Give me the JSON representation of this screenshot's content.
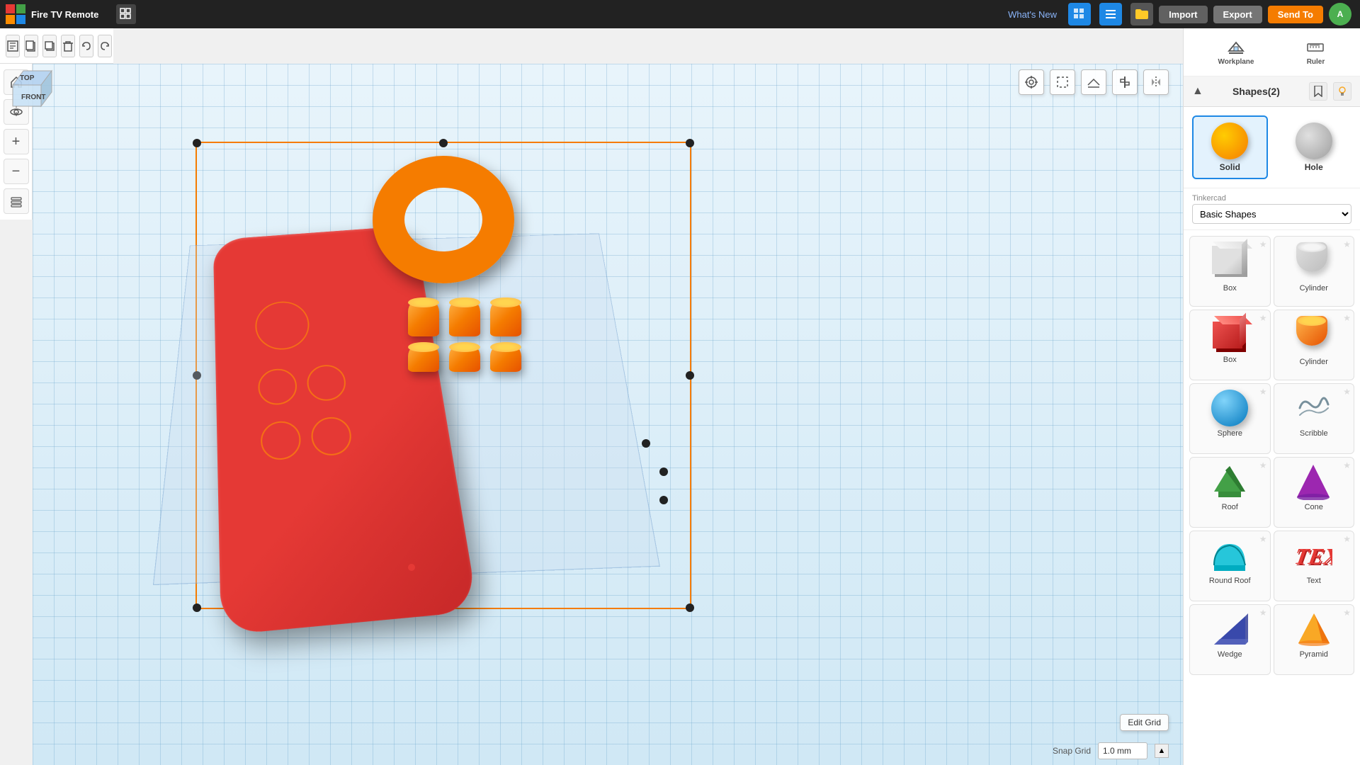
{
  "app": {
    "title": "Fire TV Remote",
    "logo_text": "TIN KER CAD"
  },
  "topbar": {
    "whats_new": "What's New",
    "import_label": "Import",
    "export_label": "Export",
    "send_to_label": "Send To"
  },
  "toolbar": {
    "new_label": "New",
    "copy_label": "Copy",
    "duplicate_label": "Duplicate",
    "delete_label": "Delete",
    "undo_label": "Undo",
    "redo_label": "Redo"
  },
  "view_cube": {
    "top_label": "TOP",
    "front_label": "FRONT"
  },
  "shapes_panel": {
    "title": "Shapes(2)",
    "solid_label": "Solid",
    "hole_label": "Hole",
    "tinkercad_label": "Tinkercad",
    "library_label": "Basic Shapes",
    "shapes": [
      {
        "name": "Box",
        "color": "gray",
        "type": "box-gray"
      },
      {
        "name": "Cylinder",
        "color": "gray",
        "type": "cyl-gray"
      },
      {
        "name": "Box",
        "color": "red",
        "type": "box-red"
      },
      {
        "name": "Cylinder",
        "color": "orange",
        "type": "cyl-orange"
      },
      {
        "name": "Sphere",
        "color": "blue",
        "type": "sphere"
      },
      {
        "name": "Scribble",
        "color": "gray",
        "type": "scribble"
      },
      {
        "name": "Roof",
        "color": "green",
        "type": "roof"
      },
      {
        "name": "Cone",
        "color": "purple",
        "type": "cone"
      },
      {
        "name": "Round Roof",
        "color": "teal",
        "type": "round-roof"
      },
      {
        "name": "Text",
        "color": "red",
        "type": "text"
      },
      {
        "name": "Wedge",
        "color": "navy",
        "type": "wedge"
      },
      {
        "name": "Pyramid",
        "color": "yellow",
        "type": "pyramid"
      }
    ]
  },
  "viewport": {
    "workplane_label": "Workplane",
    "ruler_label": "Ruler",
    "edit_grid_label": "Edit Grid",
    "snap_grid_label": "Snap Grid",
    "snap_grid_value": "1.0 mm"
  },
  "left_tools": [
    {
      "icon": "⌂",
      "name": "home"
    },
    {
      "icon": "↺",
      "name": "reset-view"
    },
    {
      "icon": "+",
      "name": "zoom-in"
    },
    {
      "icon": "−",
      "name": "zoom-out"
    },
    {
      "icon": "▦",
      "name": "layers"
    }
  ]
}
